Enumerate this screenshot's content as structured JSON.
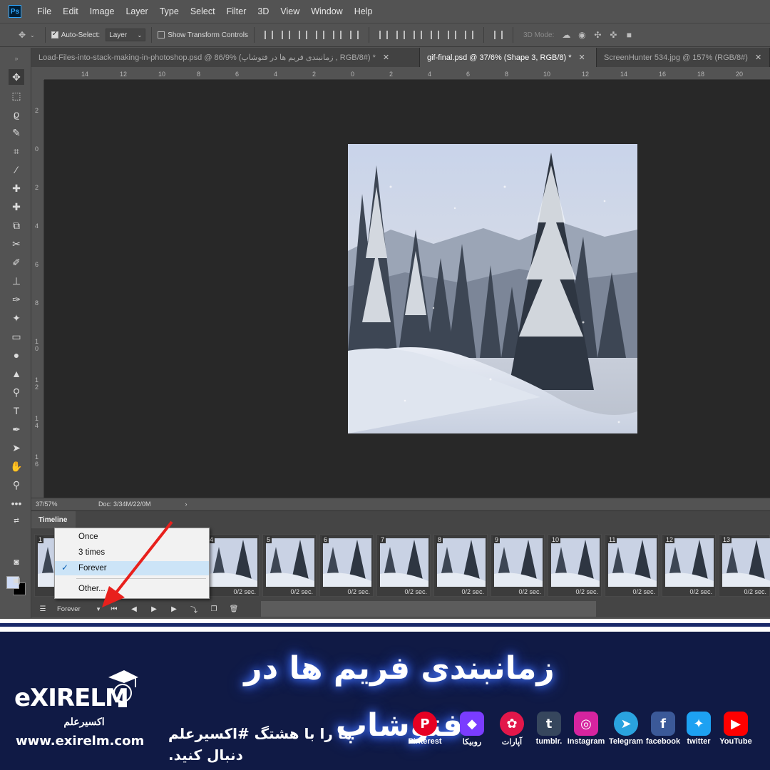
{
  "app": {
    "logo": "Ps"
  },
  "menu": [
    "File",
    "Edit",
    "Image",
    "Layer",
    "Type",
    "Select",
    "Filter",
    "3D",
    "View",
    "Window",
    "Help"
  ],
  "options": {
    "auto_select_label": "Auto-Select:",
    "auto_select_value": "Layer",
    "show_transform_label": "Show Transform Controls",
    "three_d_mode_label": "3D Mode:"
  },
  "tabs": [
    {
      "label": "Load-Files-into-stack-making-in-photoshop.psd @ 86/9% (زمانبندی فریم ها در فتوشاپ , RGB/8#) *",
      "active": false
    },
    {
      "label": "gif-final.psd @ 37/6% (Shape 3, RGB/8) *",
      "active": true
    },
    {
      "label": "ScreenHunter 534.jpg @ 157% (RGB/8#)",
      "active": false
    }
  ],
  "ruler_top_labels": [
    "14",
    "12",
    "10",
    "8",
    "6",
    "4",
    "2",
    "0",
    "2",
    "4",
    "6",
    "8",
    "10",
    "12",
    "14",
    "16",
    "18",
    "20"
  ],
  "ruler_left_labels": [
    "2",
    "0",
    "2",
    "4",
    "6",
    "8",
    "1 0",
    "1 2",
    "1 4",
    "1 6"
  ],
  "status": {
    "zoom": "37/57%",
    "doc": "Doc: 3/34M/22/0M",
    "arrow": "›"
  },
  "timeline": {
    "tab_label": "Timeline",
    "frames": [
      {
        "num": "1",
        "delay": ""
      },
      {
        "num": "4",
        "delay": "0/2 sec."
      },
      {
        "num": "5",
        "delay": "0/2 sec."
      },
      {
        "num": "6",
        "delay": "0/2 sec."
      },
      {
        "num": "7",
        "delay": "0/2 sec."
      },
      {
        "num": "8",
        "delay": "0/2 sec."
      },
      {
        "num": "9",
        "delay": "0/2 sec."
      },
      {
        "num": "10",
        "delay": "0/2 sec."
      },
      {
        "num": "11",
        "delay": "0/2 sec."
      },
      {
        "num": "12",
        "delay": "0/2 sec."
      },
      {
        "num": "13",
        "delay": "0/2 sec."
      }
    ],
    "loop_value": "Forever"
  },
  "loop_menu": {
    "items": [
      {
        "label": "Once",
        "checked": false
      },
      {
        "label": "3 times",
        "checked": false
      },
      {
        "label": "Forever",
        "checked": true
      },
      {
        "label": "Other...",
        "checked": false
      }
    ]
  },
  "banner": {
    "title": "زمانبندی فریم ها در فتوشاپ",
    "logo_text": "eXIRELM",
    "logo_sub": "اکسیرعلم",
    "url": "www.exirelm.com",
    "hashtag_line": "ما را با هشتگ #اکسیرعلم دنبال کنید.",
    "social": [
      {
        "name": "Pinterest",
        "color": "#e60023",
        "glyph": "P"
      },
      {
        "name": "روبیکا",
        "color": "#7a3cff",
        "glyph": "◆"
      },
      {
        "name": "آپارات",
        "color": "#e2174a",
        "glyph": "✿"
      },
      {
        "name": "tumblr.",
        "color": "#36465d",
        "glyph": "t"
      },
      {
        "name": "Instagram",
        "color": "#d6249f",
        "glyph": "◎"
      },
      {
        "name": "Telegram",
        "color": "#2aa3df",
        "glyph": "➤"
      },
      {
        "name": "facebook",
        "color": "#3b5998",
        "glyph": "f"
      },
      {
        "name": "twitter",
        "color": "#1da1f2",
        "glyph": "✦"
      },
      {
        "name": "YouTube",
        "color": "#ff0000",
        "glyph": "▶"
      }
    ]
  },
  "colors": {
    "ui_panel": "#535353",
    "canvas_bg": "#282828",
    "menu_check": "#cce4f7",
    "banner_bg": "#101a45",
    "annotation_arrow": "#e8201c"
  }
}
